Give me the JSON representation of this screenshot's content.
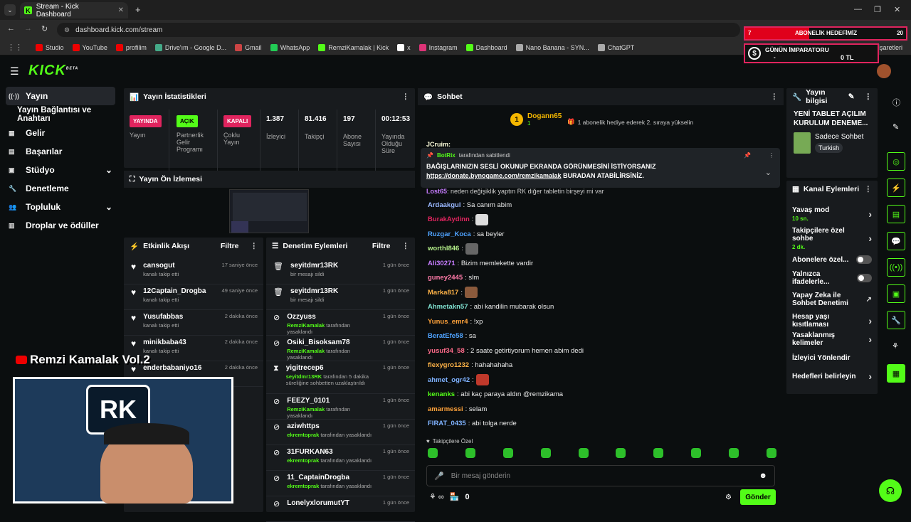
{
  "browser": {
    "tab_title": "Stream - Kick Dashboard",
    "url": "dashboard.kick.com/stream",
    "bookmarks": [
      "Studio",
      "YouTube",
      "profilim",
      "Drive'ım - Google D...",
      "Gmail",
      "WhatsApp",
      "RemziKamalak | Kick",
      "x",
      "Instagram",
      "Dashboard",
      "Nano Banana - SYN...",
      "ChatGPT"
    ],
    "bookmarks_right": "İşaretleri"
  },
  "overlay": {
    "goal_left": "7",
    "goal_title": "ABONELİK HEDEFİMİZ",
    "goal_right": "20",
    "emperor_title": "GÜNÜN İMPARATORU",
    "emperor_name": "-",
    "emperor_value": "0 TL",
    "streamer_name": "Remzi Kamalak Vol.2"
  },
  "site": {
    "logo": "KICK",
    "logo_sup": "BETA",
    "sidebar": [
      {
        "label": "Yayın",
        "icon": "broadcast-icon"
      },
      {
        "label": "Yayın Bağlantısı ve Anahtarı",
        "icon": ""
      },
      {
        "label": "Gelir",
        "icon": "income-icon"
      },
      {
        "label": "Başarılar",
        "icon": "achievements-icon"
      },
      {
        "label": "Stüdyo",
        "icon": "studio-icon"
      },
      {
        "label": "Denetleme",
        "icon": "wrench-icon"
      },
      {
        "label": "Topluluk",
        "icon": "community-icon"
      },
      {
        "label": "Droplar ve ödüller",
        "icon": "drops-icon"
      }
    ],
    "stats": {
      "title": "Yayın İstatistikleri",
      "live_badge": "YAYINDA",
      "live_label": "Yayın",
      "partner_badge": "AÇIK",
      "partner_label": "Partnerlik Gelir Programı",
      "multi_badge": "KAPALI",
      "multi_label": "Çoklu Yayın",
      "viewers": "1.387",
      "viewers_label": "İzleyici",
      "followers": "81.416",
      "followers_label": "Takipçi",
      "subs": "197",
      "subs_label": "Abone Sayısı",
      "uptime": "00:12:53",
      "uptime_label": "Yayında Olduğu Süre"
    },
    "preview_title": "Yayın Ön İzlemesi",
    "activity": {
      "title": "Etkinlik Akışı",
      "filter": "Filtre",
      "items": [
        {
          "name": "cansogut",
          "sub": "kanalı takip etti",
          "time": "17 saniye önce"
        },
        {
          "name": "12Captain_Drogba",
          "sub": "kanalı takip etti",
          "time": "49 saniye önce"
        },
        {
          "name": "Yusufabbas",
          "sub": "kanalı takip etti",
          "time": "2 dakika önce"
        },
        {
          "name": "minikbaba43",
          "sub": "kanalı takip etti",
          "time": "2 dakika önce"
        },
        {
          "name": "enderbabaniyo16",
          "sub": "",
          "time": "2 dakika önce"
        }
      ],
      "extra_times": [
        "",
        "",
        "",
        ""
      ]
    },
    "moderation": {
      "title": "Denetim Eylemleri",
      "filter": "Filtre",
      "items": [
        {
          "name": "seyitdmr13RK",
          "sub": "bir mesajı sildi",
          "actor": "",
          "time": "1 gün önce",
          "icon": "trash-icon"
        },
        {
          "name": "seyitdmr13RK",
          "sub": "bir mesajı sildi",
          "actor": "",
          "time": "1 gün önce",
          "icon": "trash-icon"
        },
        {
          "name": "Ozzyuss",
          "actor": "RemziKamalak",
          "sub": " tarafından yasaklandı",
          "time": "1 gün önce",
          "icon": "ban-icon"
        },
        {
          "name": "Osiki_Bisoksam78",
          "actor": "RemziKamalak",
          "sub": " tarafından yasaklandı",
          "time": "1 gün önce",
          "icon": "ban-icon"
        },
        {
          "name": "yigitrecep6",
          "actor": "seyitdmr13RK",
          "sub": " tarafından 5 dakika süreliğine sohbetten uzaklaştırıldı",
          "time": "1 gün önce",
          "icon": "hourglass-icon"
        },
        {
          "name": "FEEZY_0101",
          "actor": "RemziKamalak",
          "sub": " tarafından yasaklandı",
          "time": "1 gün önce",
          "icon": "ban-icon"
        },
        {
          "name": "aziwhttps",
          "actor": "ekremtoprak",
          "sub": " tarafından yasaklandı",
          "time": "1 gün önce",
          "icon": "ban-icon"
        },
        {
          "name": "31FURKAN63",
          "actor": "ekremtoprak",
          "sub": " tarafından yasaklandı",
          "time": "1 gün önce",
          "icon": "ban-icon"
        },
        {
          "name": "11_CaptainDrogba",
          "actor": "ekremtoprak",
          "sub": " tarafından yasaklandı",
          "time": "1 gün önce",
          "icon": "ban-icon"
        },
        {
          "name": "LonelyxlorumutYT",
          "actor": "",
          "sub": "",
          "time": "1 gün önce",
          "icon": "ban-icon"
        }
      ]
    },
    "chat": {
      "title": "Sohbet",
      "top_user": "Dogann65",
      "top_count": "1",
      "top_rank": "1",
      "gift_text": "1 abonelik hediye ederek 2. sıraya yükselin",
      "partial_user": "JCruim:",
      "pinned_by": "BotRix",
      "pinned_suffix": "tarafından sabitlendi",
      "pinned_line1": "BAĞIŞLARINIZIN SESLİ OKUNUP EKRANDA GÖRÜNMESİNİ İSTİYORSANIZ",
      "pinned_link": "https://donate.bynogame.com/remzikamalak",
      "pinned_line2": " BURADAN ATABİLİRSİNİZ.",
      "partial_msg_user": "Lost65",
      "partial_msg": ": neden değişiklik yaptın RK diğer tabletin birşeyi mi var",
      "messages": [
        {
          "user": "Ardaakgul",
          "text": ": Sa canım abim",
          "color": "#9ab8ff",
          "emote": ""
        },
        {
          "user": "BurakAydinn",
          "text": ":",
          "color": "#e0245e",
          "emote": "#ddd"
        },
        {
          "user": "Ruzgar_Koca",
          "text": ": sa beyler",
          "color": "#4fa3ff",
          "emote": ""
        },
        {
          "user": "worthl846",
          "text": ":",
          "color": "#b5f08a",
          "emote": "#666"
        },
        {
          "user": "Ali30271",
          "text": ": Bizim memlekette vardir",
          "color": "#c77dff",
          "emote": ""
        },
        {
          "user": "guney2445",
          "text": ": slm",
          "color": "#ff7aa8",
          "emote": ""
        },
        {
          "user": "Marka817",
          "text": ":",
          "color": "#ffb347",
          "emote": "#8b5a3c"
        },
        {
          "user": "Ahmetakn57",
          "text": ": abi kandilin mubarak olsun",
          "color": "#7fe0d0",
          "emote": ""
        },
        {
          "user": "Yunus_emr4",
          "text": ": !xp",
          "color": "#ffa23a",
          "emote": ""
        },
        {
          "user": "BeratEfe58",
          "text": ": sa",
          "color": "#4fa3ff",
          "emote": ""
        },
        {
          "user": "yusuf34_58",
          "text": ": 2 saate getirtiyorum hemen abim dedi",
          "color": "#ff6b8a",
          "emote": ""
        },
        {
          "user": "flexygro1232",
          "text": ": hahahahaha",
          "color": "#ffb347",
          "emote": ""
        },
        {
          "user": "ahmet_ogr42",
          "text": ":",
          "color": "#7fb2ff",
          "emote": "#c0392b"
        },
        {
          "user": "kenanks",
          "text": ": abi kaç paraya aldın @remzikama",
          "color": "#53fc18",
          "emote": ""
        },
        {
          "user": "amarmessi",
          "text": ": selam",
          "color": "#ffa23a",
          "emote": ""
        },
        {
          "user": "FIRAT_0435",
          "text": ": abi tolga nerde",
          "color": "#7fb2ff",
          "emote": ""
        }
      ],
      "followers_only": "Takipçilere Özel",
      "input_placeholder": "Bir mesaj gönderin",
      "points": "0",
      "send": "Gönder"
    },
    "stream_info": {
      "title": "Yayın bilgisi",
      "stream_title": "YENİ TABLET AÇILIM KURULUM DENEME...",
      "category": "Sadece Sohbet",
      "language": "Turkish"
    },
    "channel_actions": {
      "title": "Kanal Eylemleri",
      "items": [
        {
          "label": "Yavaş mod",
          "sub": "10 sn.",
          "control": "chevron"
        },
        {
          "label": "Takipçilere özel sohbe",
          "sub": "2 dk.",
          "control": "chevron"
        },
        {
          "label": "Abonelere özel...",
          "sub": "",
          "control": "toggle"
        },
        {
          "label": "Yalnızca ifadelerle...",
          "sub": "",
          "control": "toggle"
        },
        {
          "label": "Yapay Zeka ile Sohbet Denetimi",
          "sub": "",
          "control": "external"
        },
        {
          "label": "Hesap yaşı kısıtlaması",
          "sub": "",
          "control": "chevron"
        },
        {
          "label": "Yasaklanmış kelimeler",
          "sub": "",
          "control": "chevron"
        },
        {
          "label": "İzleyici Yönlendir",
          "sub": "",
          "control": "none"
        },
        {
          "label": "Hedefleri belirleyin",
          "sub": "",
          "control": "chevron"
        }
      ]
    }
  }
}
